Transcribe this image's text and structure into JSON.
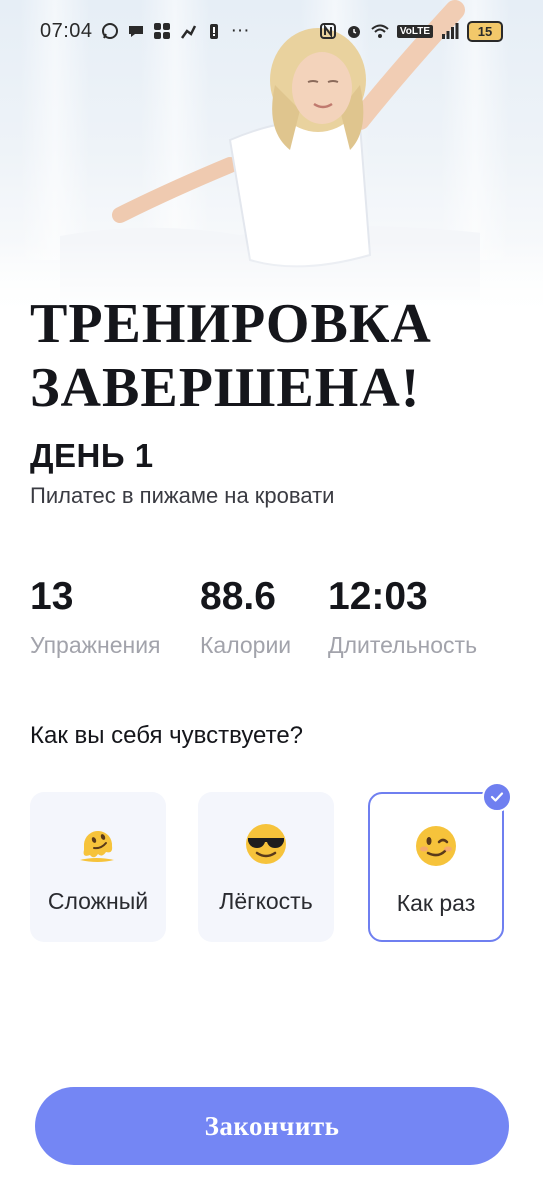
{
  "status_bar": {
    "time": "07:04",
    "dots": "···",
    "volte": "VoLTE",
    "battery": "15"
  },
  "workout": {
    "title_line1": "ТРЕНИРОВКА",
    "title_line2": "ЗАВЕРШЕНА!",
    "day": "ДЕНЬ 1",
    "subtitle": "Пилатес в пижаме на кровати"
  },
  "stats": [
    {
      "value": "13",
      "label": "Упражнения"
    },
    {
      "value": "88.6",
      "label": "Калории"
    },
    {
      "value": "12:03",
      "label": "Длительность"
    }
  ],
  "feeling": {
    "question": "Как вы себя чувствуете?",
    "options": [
      {
        "label": "Сложный",
        "icon": "melting-face-emoji",
        "selected": false
      },
      {
        "label": "Лёгкость",
        "icon": "sunglasses-emoji",
        "selected": false
      },
      {
        "label": "Как раз",
        "icon": "winking-face-emoji",
        "selected": true
      }
    ]
  },
  "finish_button": "Закончить",
  "colors": {
    "accent": "#7486f4",
    "card_bg": "#f4f6fc",
    "muted_text": "#a2a3ab"
  }
}
